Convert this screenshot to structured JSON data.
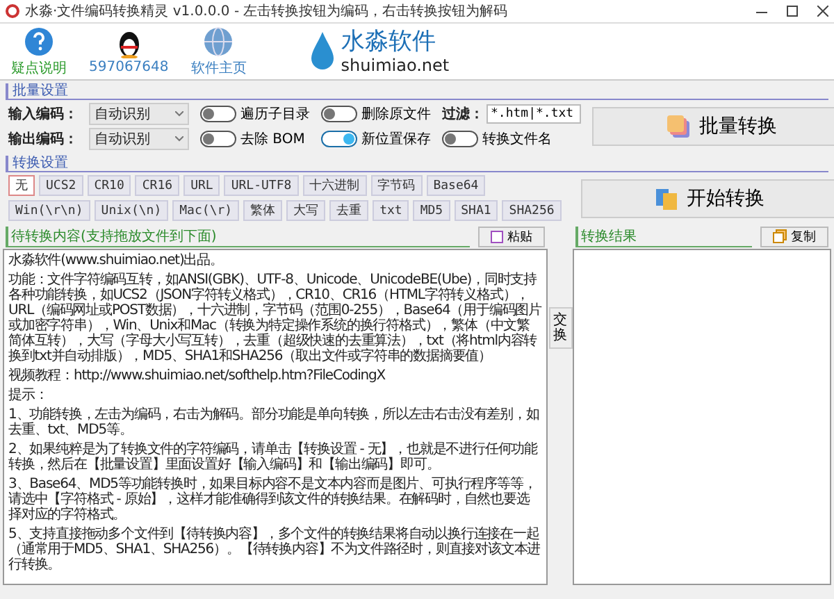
{
  "window": {
    "title": "水淼·文件编码转换精灵 v1.0.0.0 - 左击转换按钮为编码，右击转换按钮为解码"
  },
  "toolbar": [
    {
      "kind": "help",
      "label": "疑点说明"
    },
    {
      "kind": "qq",
      "label": "597067648"
    },
    {
      "kind": "globe",
      "label": "软件主页"
    }
  ],
  "logo": {
    "name": "水淼软件",
    "url": "shuimiao.net"
  },
  "batch": {
    "title": "批量设置",
    "encodings": [
      {
        "label": "输入编码：",
        "value": "自动识别"
      },
      {
        "label": "输出编码：",
        "value": "自动识别"
      }
    ],
    "toggles": [
      {
        "label": "遍历子目录",
        "on": false
      },
      {
        "label": "删除原文件",
        "on": false
      },
      {
        "label": "去除 BOM",
        "on": false
      },
      {
        "label": "新位置保存",
        "on": true
      },
      {
        "label": "转换文件名",
        "on": false
      }
    ],
    "filter": {
      "label": "过滤：",
      "value": "*.htm|*.txt"
    },
    "action": "批量转换"
  },
  "convert": {
    "title": "转换设置",
    "buttons": [
      {
        "label": "无",
        "selected": true
      },
      {
        "label": "UCS2",
        "selected": false
      },
      {
        "label": "CR10",
        "selected": false
      },
      {
        "label": "CR16",
        "selected": false
      },
      {
        "label": "URL",
        "selected": false
      },
      {
        "label": "URL-UTF8",
        "selected": false
      },
      {
        "label": "十六进制",
        "selected": false
      },
      {
        "label": "字节码",
        "selected": false
      },
      {
        "label": "Base64",
        "selected": false
      },
      {
        "label": "Win(\\r\\n)",
        "selected": false
      },
      {
        "label": "Unix(\\n)",
        "selected": false
      },
      {
        "label": "Mac(\\r)",
        "selected": false
      },
      {
        "label": "繁体",
        "selected": false
      },
      {
        "label": "大写",
        "selected": false
      },
      {
        "label": "去重",
        "selected": false
      },
      {
        "label": "txt",
        "selected": false
      },
      {
        "label": "MD5",
        "selected": false
      },
      {
        "label": "SHA1",
        "selected": false
      },
      {
        "label": "SHA256",
        "selected": false
      }
    ],
    "action": "开始转换"
  },
  "source": {
    "title": "待转换内容(支持拖放文件到下面)",
    "button": "粘贴",
    "paragraphs": [
      "水淼软件(www.shuimiao.net)出品。",
      "功能：文件字符编码互转，如ANSI(GBK)、UTF-8、Unicode、UnicodeBE(Ube)，同时支持各种功能转换，如UCS2（JSON字符转义格式），CR10、CR16（HTML字符转义格式），URL（编码网址或POST数据），十六进制，字节码（范围0-255），Base64（用于编码图片或加密字符串），Win、Unix和Mac（转换为特定操作系统的换行符格式），繁体（中文繁简体互转），大写（字母大小写互转），去重（超级快速的去重算法），txt（将html内容转换到txt并自动排版），MD5、SHA1和SHA256（取出文件或字符串的数据摘要值）",
      "视频教程：http://www.shuimiao.net/softhelp.htm?FileCodingX",
      "提示：",
      "1、功能转换，左击为编码，右击为解码。部分功能是单向转换，所以左击右击没有差别，如去重、txt、MD5等。",
      "2、如果纯粹是为了转换文件的字符编码，请单击【转换设置 - 无】，也就是不进行任何功能转换，然后在【批量设置】里面设置好【输入编码】和【输出编码】即可。",
      "3、Base64、MD5等功能转换时，如果目标内容不是文本内容而是图片、可执行程序等等，请选中【字符格式 - 原始】，这样才能准确得到该文件的转换结果。在解码时，自然也要选择对应的字符格式。",
      "5、支持直接拖动多个文件到【待转换内容】，多个文件的转换结果将自动以换行连接在一起（通常用于MD5、SHA1、SHA256）。【待转换内容】不为文件路径时，则直接对该文本进行转换。"
    ]
  },
  "swap": "交换",
  "result": {
    "title": "转换结果",
    "button": "复制"
  }
}
